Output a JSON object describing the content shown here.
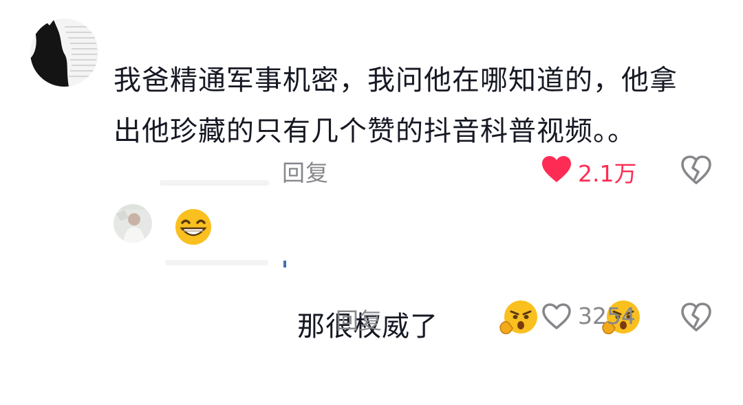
{
  "comments": [
    {
      "text": "我爸精通军事机密，我问他在哪知道的，他拿出他珍藏的只有几个赞的抖音科普视频。。",
      "emoji": "grinning-sweat-emoji",
      "reply_label": "回复",
      "like_count": "2.1万",
      "liked": true,
      "like_icon": "heart-filled-icon",
      "dislike_icon": "broken-heart-icon",
      "colors": {
        "liked": "#fe2c55",
        "muted": "#86878b"
      }
    },
    {
      "text": "那很权威了",
      "emoji": "thinking-angry-emoji",
      "reply_label": "回复",
      "like_count": "3254",
      "liked": false,
      "like_icon": "heart-outline-icon",
      "dislike_icon": "broken-heart-icon"
    }
  ]
}
